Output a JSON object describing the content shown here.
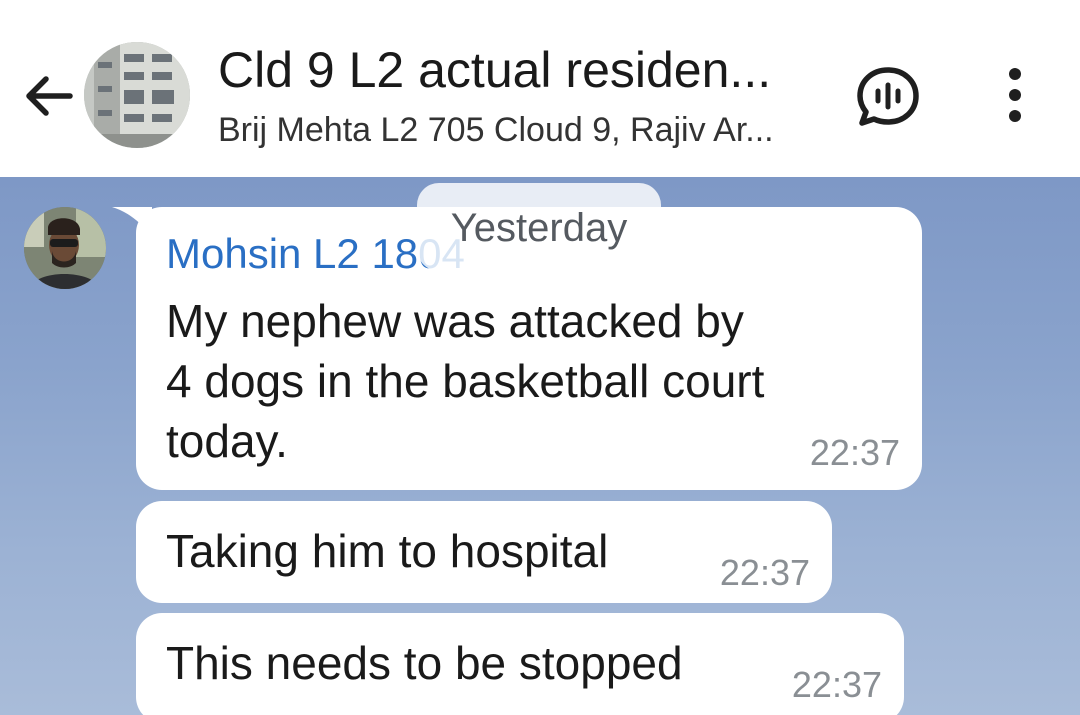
{
  "header": {
    "title": "Cld 9 L2 actual residen...",
    "subtitle": "Brij Mehta L2 705 Cloud 9, Rajiv Ar...",
    "back_icon": "arrow-left-icon",
    "voice_icon": "voice-chat-icon",
    "menu_icon": "more-vertical-icon"
  },
  "chat": {
    "date_label": "Yesterday",
    "messages": [
      {
        "sender": "Mohsin L2 1804",
        "lines": [
          "My nephew was attacked by",
          "4 dogs in the basketball court",
          "today."
        ],
        "time": "22:37"
      },
      {
        "text": "Taking him to hospital",
        "time": "22:37"
      },
      {
        "text": "This needs to be stopped",
        "time": "22:37"
      }
    ]
  },
  "colors": {
    "sender_name": "#2a6fc4",
    "chat_background": "#8aa3cc",
    "bubble": "#ffffff",
    "time": "#8a8f94"
  }
}
